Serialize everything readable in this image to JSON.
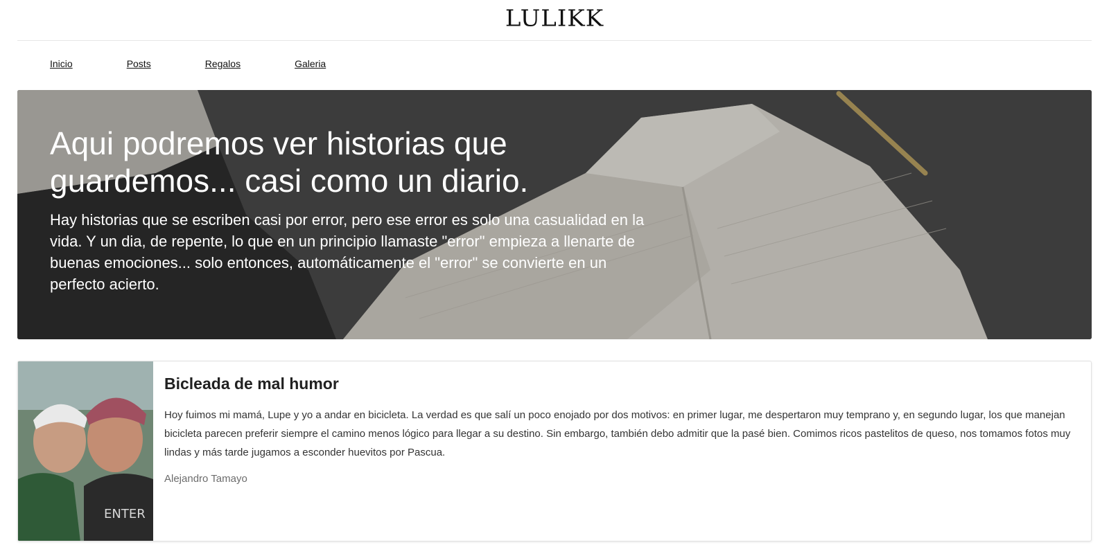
{
  "site": {
    "logo": "LULIKK"
  },
  "nav": {
    "items": [
      {
        "label": "Inicio"
      },
      {
        "label": "Posts"
      },
      {
        "label": "Regalos"
      },
      {
        "label": "Galeria"
      }
    ]
  },
  "hero": {
    "title": "Aqui podremos ver historias que guardemos... casi como un diario.",
    "lead": "Hay historias que se escriben casi por error, pero ese error es solo una casualidad en la vida. Y un dia, de repente, lo que en un principio llamaste \"error\" empieza a llenarte de buenas emociones... solo entonces, automáticamente el \"error\" se convierte en un perfecto acierto."
  },
  "post": {
    "title": "Bicleada de mal humor",
    "excerpt": "Hoy fuimos mi mamá, Lupe y yo a andar en bicicleta. La verdad es que salí un poco enojado por dos motivos: en primer lugar, me despertaron muy temprano y, en segundo lugar, los que manejan bicicleta parecen preferir siempre el camino menos lógico para llegar a su destino. Sin embargo, también debo admitir que la pasé bien. Comimos ricos pastelitos de queso, nos tomamos fotos muy lindas y más tarde jugamos a esconder huevitos por Pascua.",
    "author": "Alejandro Tamayo"
  }
}
